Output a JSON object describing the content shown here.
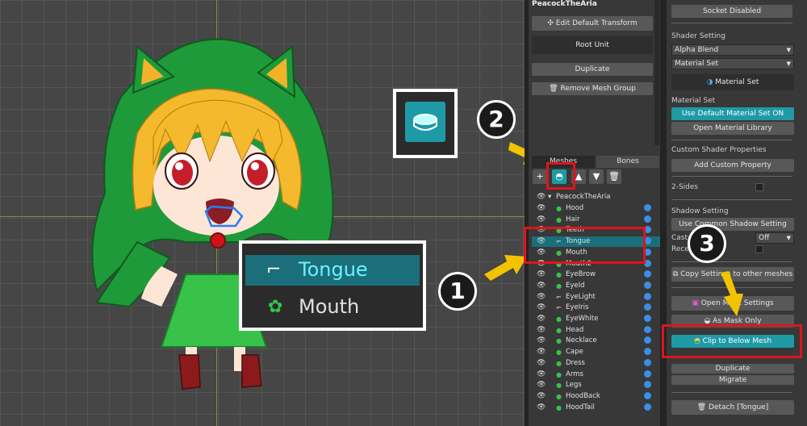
{
  "mesh_group": {
    "name": "PeacockTheAria",
    "edit_default_transform": "Edit Default Transform",
    "root_unit": "Root Unit",
    "duplicate": "Duplicate",
    "remove_mesh_group": "Remove Mesh Group"
  },
  "tabs": {
    "meshes": "Meshes",
    "bones": "Bones"
  },
  "tree": {
    "root": "PeacockTheAria",
    "items": [
      "Hood",
      "Hair",
      "Teeth",
      "Tongue",
      "Mouth",
      "Mouth2",
      "EyeBrow",
      "EyeId",
      "EyeLight",
      "EyeIris",
      "EyeWhite",
      "Head",
      "Necklace",
      "Cape",
      "Dress",
      "Arms",
      "Legs",
      "HoodBack",
      "HoodTail"
    ],
    "selected": "Tongue"
  },
  "right": {
    "socket": "Socket Disabled",
    "shader_setting": "Shader Setting",
    "alpha_blend": "Alpha Blend",
    "material_set_dd": "Material Set",
    "material_set_btn": "Material Set",
    "material_set_label": "Material Set",
    "use_default": "Use Default Material Set ON",
    "open_library": "Open Material Library",
    "custom_shader": "Custom Shader Properties",
    "add_custom": "Add Custom Property",
    "two_sides": "2-Sides",
    "shadow_setting": "Shadow Setting",
    "use_shadow": "Use Common Shadow Setting",
    "cast": "Cast",
    "off": "Off",
    "receive": "Rece",
    "copy_settings": "Copy Settings to other meshes",
    "mask_settings": "Open Mask Settings",
    "as_mask_only": "As Mask Only",
    "clip_below": "Clip to Below Mesh",
    "duplicate": "Duplicate",
    "migrate": "Migrate",
    "detach": "Detach [Tongue]"
  },
  "callout": {
    "tongue": "Tongue",
    "mouth": "Mouth"
  },
  "steps": {
    "one": "1",
    "two": "2",
    "three": "3"
  },
  "colors": {
    "accent": "#1e9aa6",
    "highlight": "#e0141c",
    "arrow": "#f2c400"
  }
}
